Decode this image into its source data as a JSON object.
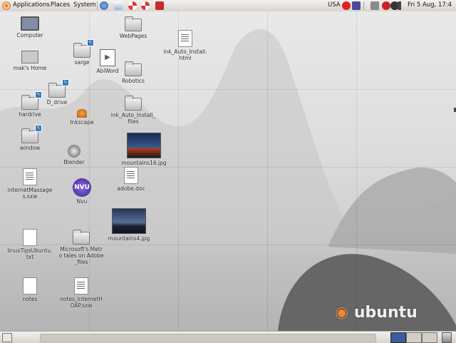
{
  "top_panel": {
    "menus": [
      "Applications",
      "Places",
      "System"
    ],
    "keyboard_layout": "USA",
    "clock": "Fri 5 Aug, 17:4",
    "launchers": [
      "globe-icon",
      "mail-icon",
      "lifebuoy-icon",
      "help-icon",
      "toolbox-icon"
    ],
    "tray": [
      "no-entry-icon",
      "notes-icon",
      "network-icon",
      "red-alert-icon",
      "power-icon",
      "volume-icon"
    ]
  },
  "desktop_icons": [
    {
      "label": "Computer",
      "icon": "computer-icon"
    },
    {
      "label": "mak's Home",
      "icon": "home-icon"
    },
    {
      "label": "sarge",
      "icon": "folder-icon"
    },
    {
      "label": "AbiWord",
      "icon": "abiword-icon"
    },
    {
      "label": "WebPages",
      "icon": "folder-icon"
    },
    {
      "label": "ink_Auto_Install.html",
      "icon": "html-doc-icon"
    },
    {
      "label": "Robotics",
      "icon": "folder-icon"
    },
    {
      "label": "D_drive",
      "icon": "folder-icon"
    },
    {
      "label": "hardrive",
      "icon": "folder-icon"
    },
    {
      "label": "Inkscape",
      "icon": "inkscape-icon"
    },
    {
      "label": "ink_Auto_Install_files",
      "icon": "folder-icon"
    },
    {
      "label": "window",
      "icon": "folder-icon"
    },
    {
      "label": "Blender",
      "icon": "blender-icon"
    },
    {
      "label": "mountains16.jpg",
      "icon": "image-icon"
    },
    {
      "label": "internetMassages.sxw",
      "icon": "doc-icon"
    },
    {
      "label": "adobe.doc",
      "icon": "doc-icon"
    },
    {
      "label": "Nvu",
      "icon": "nvu-icon"
    },
    {
      "label": "mountains4.jpg",
      "icon": "image-icon"
    },
    {
      "label": "linuxTipsUbuntu.txt",
      "icon": "text-icon"
    },
    {
      "label": "Microsoft's Metro tales on Adobe_files",
      "icon": "folder-icon"
    },
    {
      "label": "notes",
      "icon": "text-icon"
    },
    {
      "label": "notes_internetHOAP.sxw",
      "icon": "doc-icon"
    }
  ],
  "badge_mark": "↖",
  "nvu_text": "NVU",
  "wallpaper_brand": "ubuntu"
}
